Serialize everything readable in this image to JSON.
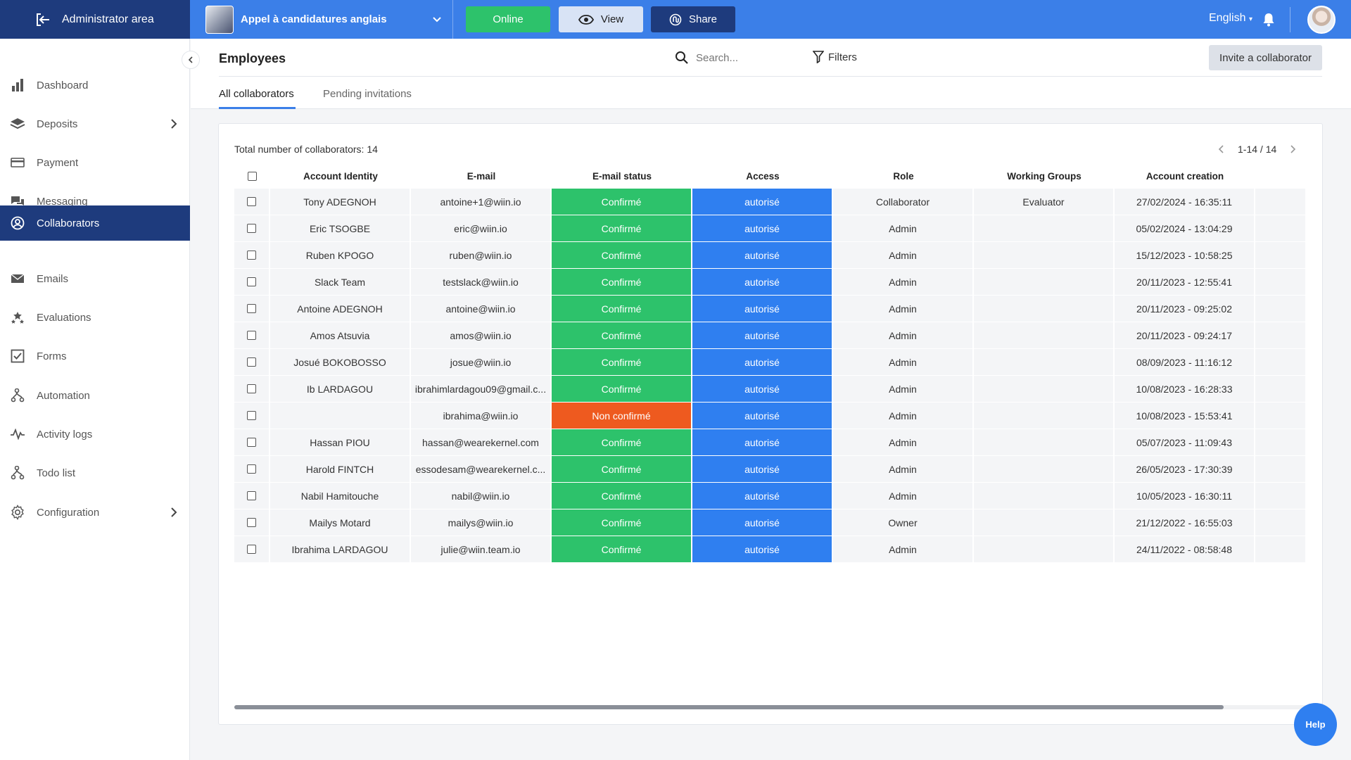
{
  "topbar": {
    "admin_area": "Administrator area",
    "campaign_title": "Appel à candidatures anglais",
    "online_label": "Online",
    "view_label": "View",
    "share_label": "Share",
    "language": "English",
    "colors": {
      "bar": "#3b7fe8",
      "dark": "#1e3b7d",
      "online": "#2dc26b"
    }
  },
  "sidebar": {
    "items": [
      {
        "label": "Dashboard",
        "icon": "bar-chart-icon"
      },
      {
        "label": "Deposits",
        "icon": "layers-icon",
        "expandable": true
      },
      {
        "label": "Payment",
        "icon": "credit-card-icon"
      },
      {
        "label": "Messaging",
        "icon": "chat-icon"
      },
      {
        "label": "Collaborators",
        "icon": "user-circle-icon",
        "active": true
      },
      {
        "label": "Emails",
        "icon": "envelope-icon"
      },
      {
        "label": "Evaluations",
        "icon": "stars-icon"
      },
      {
        "label": "Forms",
        "icon": "checkbox-icon"
      },
      {
        "label": "Automation",
        "icon": "route-icon"
      },
      {
        "label": "Activity logs",
        "icon": "activity-icon"
      },
      {
        "label": "Todo list",
        "icon": "route-icon"
      },
      {
        "label": "Configuration",
        "icon": "gear-icon",
        "expandable": true
      }
    ]
  },
  "header": {
    "title": "Employees",
    "search_placeholder": "Search...",
    "filters_label": "Filters",
    "invite_label": "Invite a collaborator",
    "tabs": [
      "All collaborators",
      "Pending invitations"
    ]
  },
  "table": {
    "total_label": "Total number of collaborators: 14",
    "pager": "1-14 / 14",
    "columns": [
      "Account Identity",
      "E-mail",
      "E-mail status",
      "Access",
      "Role",
      "Working Groups",
      "Account creation"
    ],
    "rows": [
      {
        "name": "Tony ADEGNOH",
        "email": "antoine+1@wiin.io",
        "status": "Confirmé",
        "access": "autorisé",
        "role": "Collaborator",
        "groups": "Evaluator",
        "created": "27/02/2024 - 16:35:11"
      },
      {
        "name": "Eric TSOGBE",
        "email": "eric@wiin.io",
        "status": "Confirmé",
        "access": "autorisé",
        "role": "Admin",
        "groups": "",
        "created": "05/02/2024 - 13:04:29"
      },
      {
        "name": "Ruben KPOGO",
        "email": "ruben@wiin.io",
        "status": "Confirmé",
        "access": "autorisé",
        "role": "Admin",
        "groups": "",
        "created": "15/12/2023 - 10:58:25"
      },
      {
        "name": "Slack Team",
        "email": "testslack@wiin.io",
        "status": "Confirmé",
        "access": "autorisé",
        "role": "Admin",
        "groups": "",
        "created": "20/11/2023 - 12:55:41"
      },
      {
        "name": "Antoine ADEGNOH",
        "email": "antoine@wiin.io",
        "status": "Confirmé",
        "access": "autorisé",
        "role": "Admin",
        "groups": "",
        "created": "20/11/2023 - 09:25:02"
      },
      {
        "name": "Amos Atsuvia",
        "email": "amos@wiin.io",
        "status": "Confirmé",
        "access": "autorisé",
        "role": "Admin",
        "groups": "",
        "created": "20/11/2023 - 09:24:17"
      },
      {
        "name": "Josué BOKOBOSSO",
        "email": "josue@wiin.io",
        "status": "Confirmé",
        "access": "autorisé",
        "role": "Admin",
        "groups": "",
        "created": "08/09/2023 - 11:16:12"
      },
      {
        "name": "Ib LARDAGOU",
        "email": "ibrahimlardagou09@gmail.c...",
        "status": "Confirmé",
        "access": "autorisé",
        "role": "Admin",
        "groups": "",
        "created": "10/08/2023 - 16:28:33"
      },
      {
        "name": "",
        "email": "ibrahima@wiin.io",
        "status": "Non confirmé",
        "access": "autorisé",
        "role": "Admin",
        "groups": "",
        "created": "10/08/2023 - 15:53:41"
      },
      {
        "name": "Hassan PIOU",
        "email": "hassan@wearekernel.com",
        "status": "Confirmé",
        "access": "autorisé",
        "role": "Admin",
        "groups": "",
        "created": "05/07/2023 - 11:09:43"
      },
      {
        "name": "Harold FINTCH",
        "email": "essodesam@wearekernel.c...",
        "status": "Confirmé",
        "access": "autorisé",
        "role": "Admin",
        "groups": "",
        "created": "26/05/2023 - 17:30:39"
      },
      {
        "name": "Nabil Hamitouche",
        "email": "nabil@wiin.io",
        "status": "Confirmé",
        "access": "autorisé",
        "role": "Admin",
        "groups": "",
        "created": "10/05/2023 - 16:30:11"
      },
      {
        "name": "Mailys Motard",
        "email": "mailys@wiin.io",
        "status": "Confirmé",
        "access": "autorisé",
        "role": "Owner",
        "groups": "",
        "created": "21/12/2022 - 16:55:03"
      },
      {
        "name": "Ibrahima LARDAGOU",
        "email": "julie@wiin.team.io",
        "status": "Confirmé",
        "access": "autorisé",
        "role": "Admin",
        "groups": "",
        "created": "24/11/2022 - 08:58:48"
      }
    ],
    "status_colors": {
      "confirmed": "#2dc26b",
      "unconfirmed": "#ee5a1f",
      "authorized": "#2f7ff0"
    }
  },
  "help_label": "Help"
}
